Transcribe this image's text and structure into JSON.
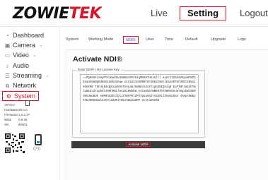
{
  "brand": {
    "logo_main": "ZOWIE",
    "logo_accent": "TEK"
  },
  "header": {
    "live": "Live",
    "setting": "Setting",
    "logout": "Logout"
  },
  "sidebar": {
    "items": [
      {
        "label": "Dashboard",
        "icon": "dashboard-icon",
        "chevron": ""
      },
      {
        "label": "Camera",
        "icon": "camera-icon",
        "chevron": "⌄"
      },
      {
        "label": "Video",
        "icon": "video-icon",
        "chevron": "⌄"
      },
      {
        "label": "Audio",
        "icon": "audio-icon",
        "chevron": ""
      },
      {
        "label": "Streaming",
        "icon": "streaming-icon",
        "chevron": "⌄"
      },
      {
        "label": "Network",
        "icon": "network-icon",
        "chevron": ""
      },
      {
        "label": "System",
        "icon": "system-icon",
        "chevron": ""
      }
    ]
  },
  "info": {
    "version_label": "Version",
    "version_value": "",
    "hardware_label": "Hardware",
    "hardware_value": "20.0.0",
    "firmware_label": "Firmware",
    "firmware_value": "1.0.2.37",
    "web_label": "WEB",
    "web_value": "0.8.46",
    "sn_label": "SN",
    "sn_value": "80001"
  },
  "subnav": {
    "items": [
      {
        "label": "System"
      },
      {
        "label": "Working Mode"
      },
      {
        "label": "NDI®"
      },
      {
        "label": "User"
      },
      {
        "label": "Time"
      },
      {
        "label": "Default"
      },
      {
        "label": "Upgrade"
      },
      {
        "label": "Logs"
      }
    ],
    "active_index": 2
  },
  "ndi": {
    "title": "Activate NDI®",
    "legend": "Enter NDI® | HX License Key",
    "license_key": "==PQE9ZkzaUpPTX16wkRvSUBHGzRPZ51qMERUTUk2Ulll aaZrJXZmhSZEpoWFBZbDXa4k5W9Q0dNSX1UNkUVGqw UiVid21Od0RBTUF3REdINGt1EakdOTUF3REtINWxiSEeERB TkF4akdaQX1qekRnTk9yamJ5mNDcGdoYV1pbUNIQX1q0 EpFTWF4akIOTWlqNkdzZF1pbkhJMHhMN2lwV2R1RW5hW k4za05GYWBRR3hTOWRVNVuwT0gxbWI0OMVNVUmdWUk A0MHhOZE4lQl1STWFPRlZPSTpDaVNJYVdp01lVk0XpDak 4Ympr0WEphOWJHMGNCWlZsVVJaZHRlYW1sSWp2aURP VnJtaG5SSW",
    "activate_label": "Activate NDI®"
  },
  "colors": {
    "accent": "#d6142a",
    "button_bg": "#3b3b3b",
    "link": "#2a58c6"
  }
}
